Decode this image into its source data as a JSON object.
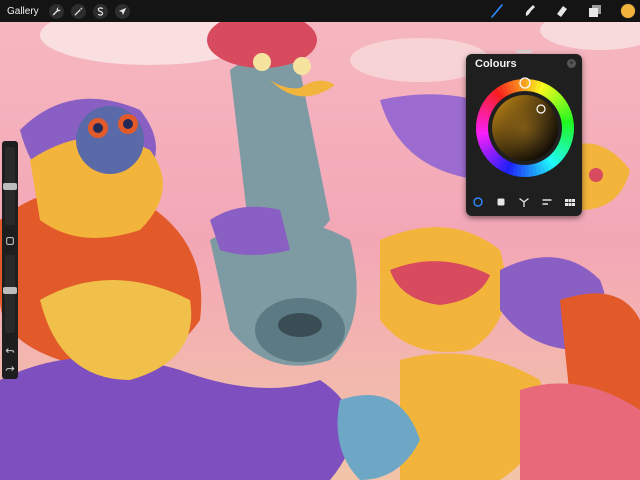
{
  "topbar": {
    "gallery_label": "Gallery",
    "actions_icon": "wrench-icon",
    "adjustments_icon": "magic-wand-icon",
    "selection_icon": "selection-s-icon",
    "transform_icon": "arrow-cursor-icon",
    "brush_icon": "brush-icon",
    "smudge_icon": "smudge-icon",
    "eraser_icon": "eraser-icon",
    "layers_icon": "layers-icon",
    "active_tool": "brush",
    "current_color": "#f2b43a",
    "accent_color": "#2f8cff"
  },
  "sidebar": {
    "brush_size_level": 0.5,
    "opacity_level": 0.55,
    "modify_button_icon": "square-icon",
    "undo_icon": "undo-icon",
    "redo_icon": "redo-icon"
  },
  "colours_panel": {
    "title": "Colours",
    "close_icon": "close-icon",
    "selected_color": "#e8a41a",
    "modes": [
      "disc",
      "classic",
      "harmony",
      "value",
      "palettes"
    ],
    "active_mode": "disc"
  },
  "canvas": {
    "description_colors": [
      "#f4b6c0",
      "#8a5fc4",
      "#e25a2a",
      "#f2b43a",
      "#7e9aa2",
      "#d84b5e"
    ]
  }
}
